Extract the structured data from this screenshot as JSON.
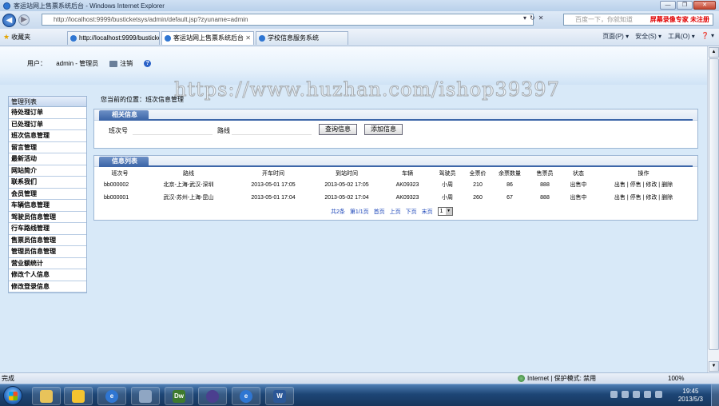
{
  "window": {
    "title": "客运站网上售票系统后台 - Windows Internet Explorer",
    "buttons": [
      "—",
      "❐",
      "✕"
    ]
  },
  "address_bar": {
    "url": "http://localhost:9999/busticketsys/admin/default.jsp?zyuname=admin",
    "search_placeholder": "百度一下，你就知道",
    "overlay_text": "屏幕录像专家 未注册"
  },
  "favorites_bar": {
    "favorites_label": "收藏夹",
    "tabs": [
      {
        "label": "http://localhost:9999/busticketsys/sc..."
      },
      {
        "label": "客运站网上售票系统后台",
        "active": true
      },
      {
        "label": "学校信息服务系统"
      }
    ],
    "commands": [
      "页面(P) ▾",
      "安全(S) ▾",
      "工具(O) ▾",
      "❓ ▾"
    ]
  },
  "header": {
    "user_label": "用户：",
    "user_value": "admin - 管理员",
    "logout_label": "注销"
  },
  "watermark": "https://www.huzhan.com/ishop39397",
  "menu": {
    "title": "管理列表",
    "items": [
      "待处理订单",
      "已处理订单",
      "班次信息管理",
      "留言管理",
      "最新活动",
      "网站简介",
      "联系我们",
      "会员管理",
      "车辆信息管理",
      "驾驶员信息管理",
      "行车路线管理",
      "售票员信息管理",
      "管理员信息管理",
      "营业额统计",
      "修改个人信息",
      "修改登录信息"
    ]
  },
  "breadcrumb": "您当前的位置：班次信息管理",
  "search_panel": {
    "title": "相关信息",
    "field1_label": "班次号",
    "field2_label": "路线",
    "query_button": "查询信息",
    "add_button": "添加信息"
  },
  "list_panel": {
    "title": "信息列表",
    "columns": [
      "班次号",
      "路线",
      "开车时间",
      "到站时间",
      "车辆",
      "驾驶员",
      "全票价",
      "余票数量",
      "售票员",
      "状态",
      "操作"
    ],
    "rows": [
      {
        "id": "bb000002",
        "route": "北京-上海-武汉-深圳",
        "depart": "2013-05-01 17:05",
        "arrive": "2013-05-02 17:05",
        "vehicle": "AK09323",
        "driver": "小周",
        "price": "210",
        "remaining": "86",
        "seller": "888",
        "status": "出售中",
        "actions": [
          "出售",
          "停售",
          "修改",
          "删除"
        ]
      },
      {
        "id": "bb000001",
        "route": "武汉-苏州-上海-昆山",
        "depart": "2013-05-01 17:04",
        "arrive": "2013-05-02 17:04",
        "vehicle": "AK09323",
        "driver": "小周",
        "price": "260",
        "remaining": "67",
        "seller": "888",
        "status": "出售中",
        "actions": [
          "出售",
          "停售",
          "修改",
          "删除"
        ]
      }
    ],
    "pager": {
      "total": "共2条",
      "page_info": "第1/1页",
      "first": "首页",
      "prev": "上页",
      "next": "下页",
      "last": "末页",
      "current": "1"
    }
  },
  "status_bar": {
    "left": "完成",
    "zone": "Internet | 保护模式: 禁用",
    "zoom": "100%"
  },
  "taskbar": {
    "apps": [
      "explorer",
      "sticky-notes",
      "internet-explorer",
      "tools",
      "dreamweaver",
      "eclipse",
      "internet-explorer-2",
      "word"
    ],
    "time": "19:45",
    "date": "2013/5/3"
  }
}
